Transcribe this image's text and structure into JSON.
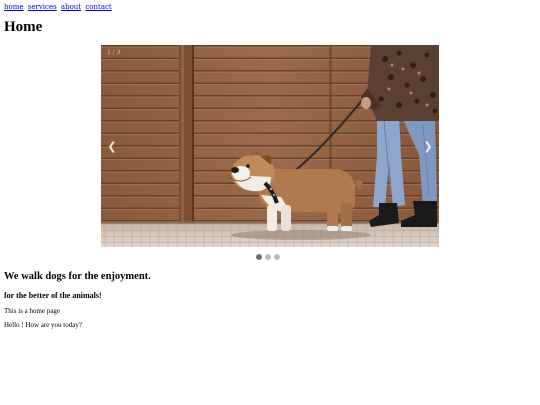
{
  "nav": {
    "items": [
      {
        "label": "home"
      },
      {
        "label": "services"
      },
      {
        "label": "about"
      },
      {
        "label": "contact"
      }
    ]
  },
  "page_title": "Home",
  "carousel": {
    "image_icon": "dog-walking-photo",
    "prev_icon": "chevron-left-icon",
    "next_icon": "chevron-right-icon",
    "prev_glyph": "❮",
    "next_glyph": "❯",
    "slide_count": 3,
    "active_slide": 1,
    "colors": {
      "dot_active": "#717171",
      "dot_inactive": "#bbbbbb"
    }
  },
  "content": {
    "headline": "We walk dogs for the enjoyment.",
    "subheadline": "for the better of the animals!",
    "paragraph_1": "This is a home page",
    "paragraph_2": "Hello ! How are you today?"
  },
  "colors": {
    "link": "#0000ee",
    "background": "#ffffff",
    "text": "#000000"
  }
}
